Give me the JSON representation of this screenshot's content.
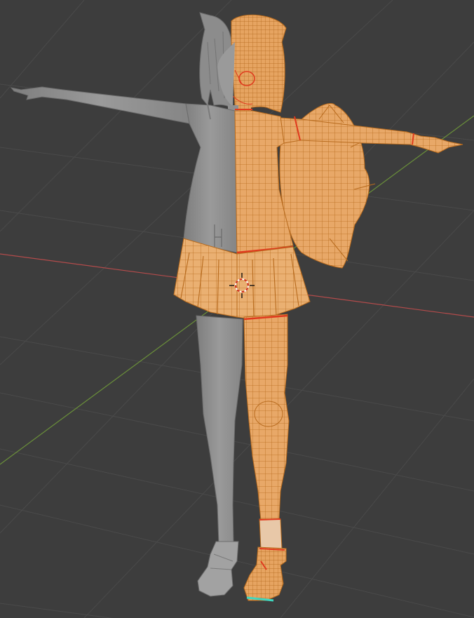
{
  "viewport": {
    "background_color": "#3d3d3d",
    "grid_line_color": "#4a4a4a",
    "x_axis_color": "#b34b4b",
    "y_axis_color": "#6a8f3a"
  },
  "model": {
    "mesh_color": "#e8a868",
    "wire_color": "#b86b1e",
    "seam_color": "#e03a1e",
    "unselected_color": "#909090",
    "unselected_shade": "#7a7a7a"
  },
  "cursor_3d": {
    "icon": "3d-cursor-icon"
  }
}
